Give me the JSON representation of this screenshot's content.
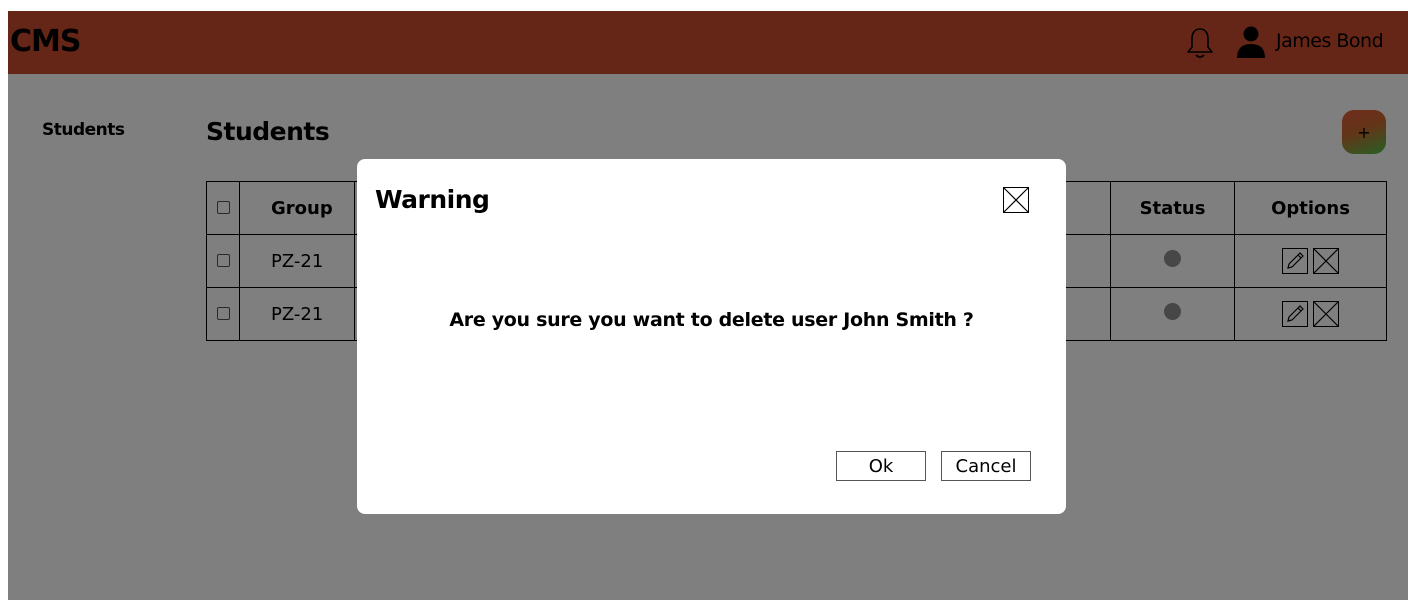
{
  "header": {
    "brand": "CMS",
    "user_name": "James Bond",
    "accent_color": "#ca4d30"
  },
  "sidebar": {
    "items": [
      {
        "label": "Students"
      }
    ]
  },
  "main": {
    "title": "Students",
    "add_button_label": "+",
    "table": {
      "columns": [
        "Group",
        "Status",
        "Options"
      ],
      "rows": [
        {
          "group": "PZ-21"
        },
        {
          "group": "PZ-21"
        }
      ]
    }
  },
  "modal": {
    "title": "Warning",
    "message": "Are you sure you want to delete user John Smith ?",
    "ok_label": "Ok",
    "cancel_label": "Cancel"
  }
}
